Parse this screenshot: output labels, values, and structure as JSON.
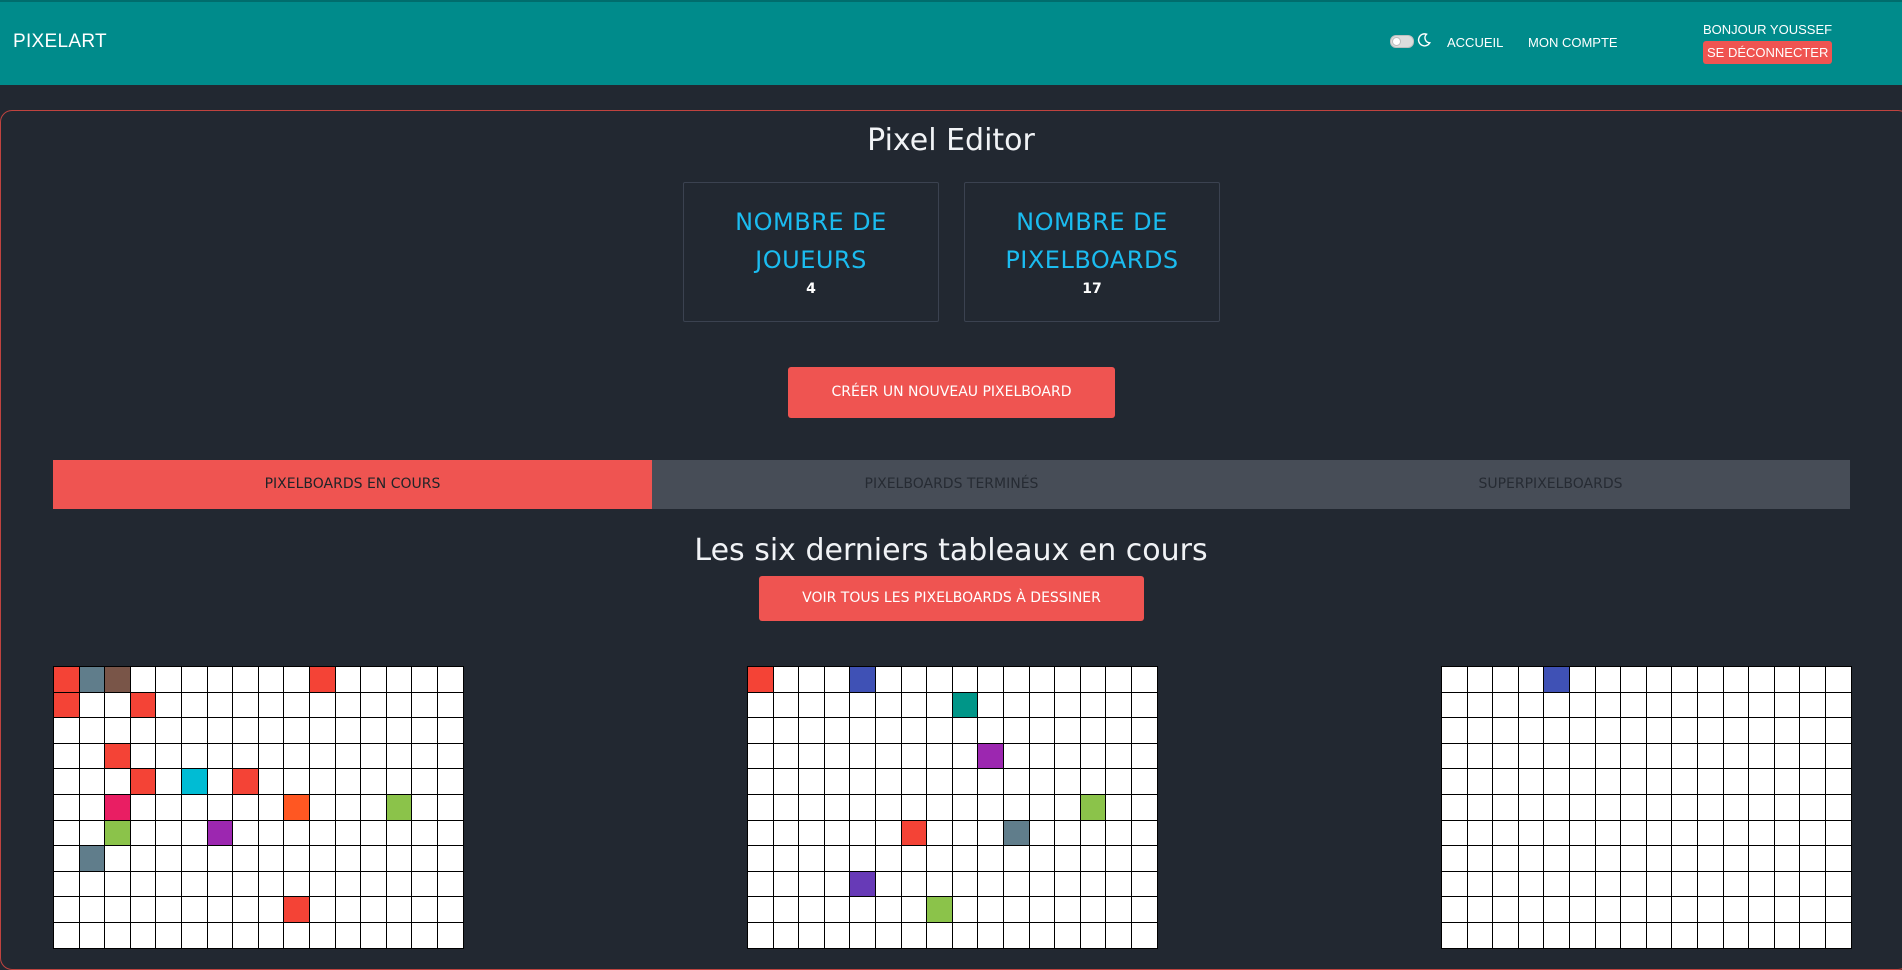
{
  "nav": {
    "brand": "PIXELART",
    "links": [
      "ACCUEIL",
      "MON COMPTE"
    ],
    "greeting": "BONJOUR YOUSSEF",
    "logout_label": "SE DÉCONNECTER",
    "theme_toggle_icon": "toggle-switch-icon",
    "theme_icon": "moon-icon"
  },
  "page_title": "Pixel Editor",
  "stats": [
    {
      "label": "NOMBRE DE JOUEURS",
      "value": "4"
    },
    {
      "label": "NOMBRE DE PIXELBOARDS",
      "value": "17"
    }
  ],
  "create_button": "CRÉER UN NOUVEAU PIXELBOARD",
  "tabs": [
    {
      "label": "PIXELBOARDS EN COURS",
      "active": true
    },
    {
      "label": "PIXELBOARDS TERMINÉS",
      "active": false
    },
    {
      "label": "SUPERPIXELBOARDS",
      "active": false
    }
  ],
  "section_title": "Les six derniers tableaux en cours",
  "view_all_button": "VOIR TOUS LES PIXELBOARDS À DESSINER",
  "colors": {
    "navbar": "#008b8b",
    "accent": "#ef5451",
    "background": "#222831",
    "stat_label": "#1bbcf0"
  },
  "boards": [
    {
      "grid_cols": 16,
      "visible_rows": 11,
      "pixels": [
        {
          "row": 0,
          "col": 0,
          "color": "#f44336"
        },
        {
          "row": 0,
          "col": 1,
          "color": "#607d8b"
        },
        {
          "row": 0,
          "col": 2,
          "color": "#795548"
        },
        {
          "row": 0,
          "col": 10,
          "color": "#f44336"
        },
        {
          "row": 1,
          "col": 0,
          "color": "#f44336"
        },
        {
          "row": 1,
          "col": 3,
          "color": "#f44336"
        },
        {
          "row": 3,
          "col": 2,
          "color": "#f44336"
        },
        {
          "row": 4,
          "col": 3,
          "color": "#f44336"
        },
        {
          "row": 4,
          "col": 5,
          "color": "#00bcd4"
        },
        {
          "row": 4,
          "col": 7,
          "color": "#f44336"
        },
        {
          "row": 5,
          "col": 2,
          "color": "#e91e63"
        },
        {
          "row": 5,
          "col": 9,
          "color": "#ff5722"
        },
        {
          "row": 5,
          "col": 13,
          "color": "#8bc34a"
        },
        {
          "row": 6,
          "col": 2,
          "color": "#8bc34a"
        },
        {
          "row": 6,
          "col": 6,
          "color": "#9c27b0"
        },
        {
          "row": 7,
          "col": 1,
          "color": "#607d8b"
        },
        {
          "row": 9,
          "col": 9,
          "color": "#f44336"
        }
      ]
    },
    {
      "grid_cols": 16,
      "visible_rows": 11,
      "pixels": [
        {
          "row": 0,
          "col": 0,
          "color": "#f44336"
        },
        {
          "row": 0,
          "col": 4,
          "color": "#3f51b5"
        },
        {
          "row": 1,
          "col": 8,
          "color": "#009688"
        },
        {
          "row": 3,
          "col": 9,
          "color": "#9c27b0"
        },
        {
          "row": 5,
          "col": 13,
          "color": "#8bc34a"
        },
        {
          "row": 6,
          "col": 6,
          "color": "#f44336"
        },
        {
          "row": 6,
          "col": 10,
          "color": "#607d8b"
        },
        {
          "row": 8,
          "col": 4,
          "color": "#673ab7"
        },
        {
          "row": 9,
          "col": 7,
          "color": "#8bc34a"
        }
      ]
    },
    {
      "grid_cols": 16,
      "visible_rows": 11,
      "pixels": [
        {
          "row": 0,
          "col": 4,
          "color": "#3f51b5"
        }
      ]
    }
  ]
}
